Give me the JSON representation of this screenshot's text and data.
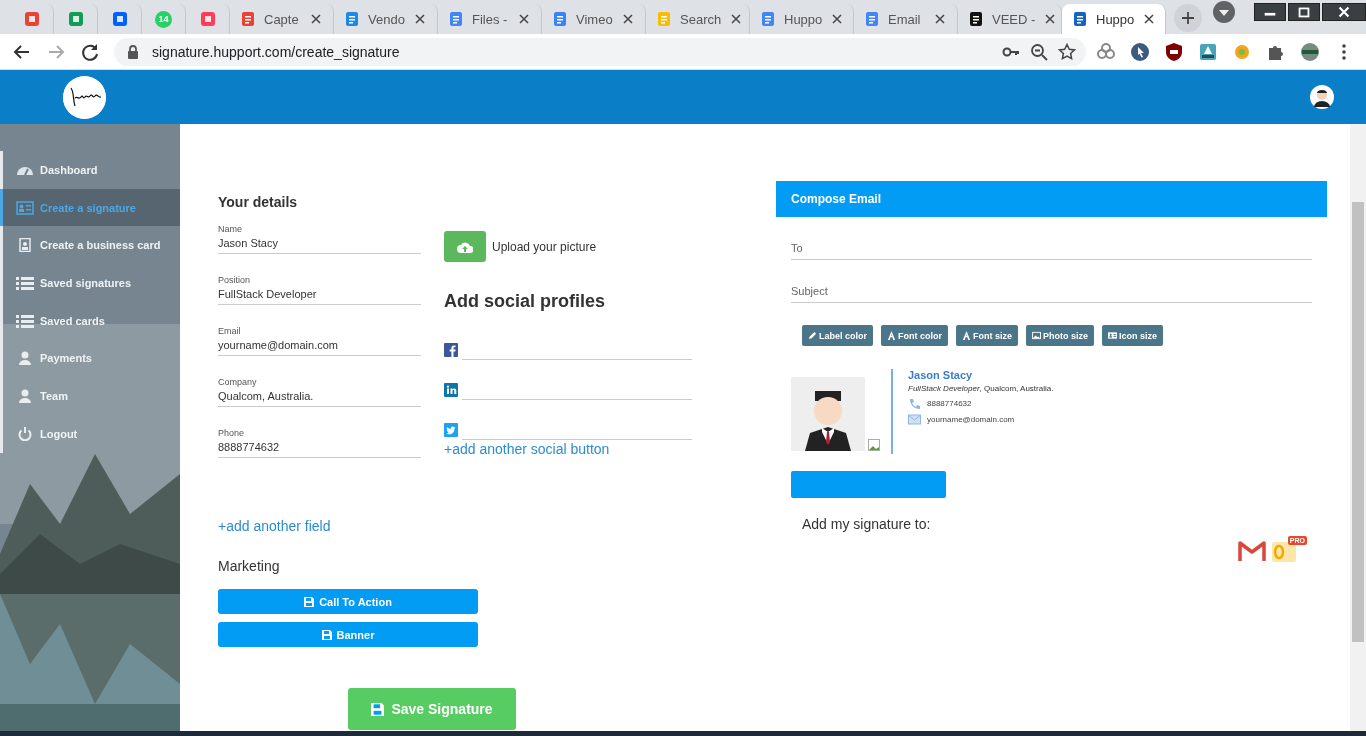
{
  "browser": {
    "tabs": [
      {
        "kind": "pinned",
        "selected": false
      },
      {
        "kind": "pinned",
        "selected": false
      },
      {
        "kind": "pinned",
        "selected": false
      },
      {
        "kind": "pinned",
        "badge": "14",
        "selected": false
      },
      {
        "kind": "pinned",
        "selected": false
      },
      {
        "kind": "normal",
        "title": "Capte",
        "selected": false
      },
      {
        "kind": "normal",
        "title": "Vendo",
        "selected": false
      },
      {
        "kind": "normal",
        "title": "Files -",
        "selected": false
      },
      {
        "kind": "normal",
        "title": "Vimeo",
        "selected": false
      },
      {
        "kind": "normal",
        "title": "Search",
        "selected": false
      },
      {
        "kind": "normal",
        "title": "Huppo",
        "selected": false
      },
      {
        "kind": "normal",
        "title": "Email",
        "selected": false
      },
      {
        "kind": "normal",
        "title": "VEED -",
        "selected": false
      },
      {
        "kind": "normal",
        "title": "Huppo",
        "selected": true
      }
    ],
    "url": "signature.hupport.com/create_signature"
  },
  "sidebar": {
    "items": [
      {
        "label": "Dashboard",
        "kind": "gauge",
        "selected": false
      },
      {
        "label": "Create a signature",
        "kind": "card",
        "selected": true
      },
      {
        "label": "Create a business card",
        "kind": "badge",
        "selected": false
      },
      {
        "label": "Saved signatures",
        "kind": "list",
        "selected": false
      },
      {
        "label": "Saved cards",
        "kind": "list",
        "selected": false
      },
      {
        "label": "Payments",
        "kind": "user",
        "selected": false
      },
      {
        "label": "Team",
        "kind": "user",
        "selected": false
      },
      {
        "label": "Logout",
        "kind": "power",
        "selected": false
      }
    ]
  },
  "details": {
    "title": "Your details",
    "fields": [
      {
        "label": "Name",
        "value": "Jason Stacy"
      },
      {
        "label": "Position",
        "value": "FullStack Developer"
      },
      {
        "label": "Email",
        "value": "yourname@domain.com"
      },
      {
        "label": "Company",
        "value": "Qualcom, Australia."
      },
      {
        "label": "Phone",
        "value": "8888774632"
      }
    ],
    "add_field": "+add another field"
  },
  "upload": {
    "label": "Upload your picture"
  },
  "social": {
    "title": "Add social profiles",
    "profiles": [
      {
        "kind": "facebook"
      },
      {
        "kind": "linkedin"
      },
      {
        "kind": "twitter"
      }
    ],
    "add_link": "+add another social button"
  },
  "marketing": {
    "title": "Marketing",
    "buttons": [
      "Call To Action",
      "Banner"
    ]
  },
  "save_button": "Save Signature",
  "compose": {
    "title": "Compose Email",
    "fields": [
      {
        "placeholder": "To"
      },
      {
        "placeholder": "Subject"
      }
    ],
    "tools": [
      {
        "label": "Label color",
        "kind": "pen"
      },
      {
        "label": "Font color",
        "kind": "font"
      },
      {
        "label": "Font size",
        "kind": "font"
      },
      {
        "label": "Photo size"
      },
      {
        "label": "Icon size",
        "kind": "idcard"
      }
    ]
  },
  "signature": {
    "name": "Jason Stacy",
    "line": "*FullStack Developer*, Qualcom, Australia.",
    "phone": "8888774632",
    "email": "yourname@domain.com"
  },
  "add_to": {
    "title": "Add my signature to:",
    "targets": [
      {
        "kind": "gmail"
      },
      {
        "kind": "outlook",
        "badge": "PRO"
      }
    ]
  }
}
